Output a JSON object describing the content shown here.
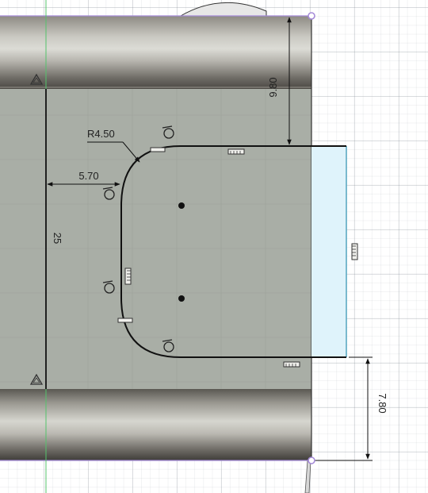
{
  "viewport": {
    "app": "CAD sketch editor",
    "tool": "sketch"
  },
  "dimensions": {
    "fillet_radius": "R4.50",
    "offset_horizontal": "5.70",
    "height_vertical": "25",
    "top_gap": "9.80",
    "bottom_gap": "7.80"
  },
  "colors": {
    "sketch_region": "#a9aea6",
    "rail_highlight": "#d8d8d2",
    "rail_shadow": "#4a4843",
    "profile_line": "#111111",
    "selection_fill": "#dff3fb",
    "selection_edge": "#6cc9e8",
    "point_marker": "#a58ad8",
    "axis_line": "#54c36b"
  },
  "icons": [
    "tangent-constraint-icon",
    "horizontal-constraint-icon",
    "vertical-constraint-icon",
    "fix-constraint-icon"
  ]
}
